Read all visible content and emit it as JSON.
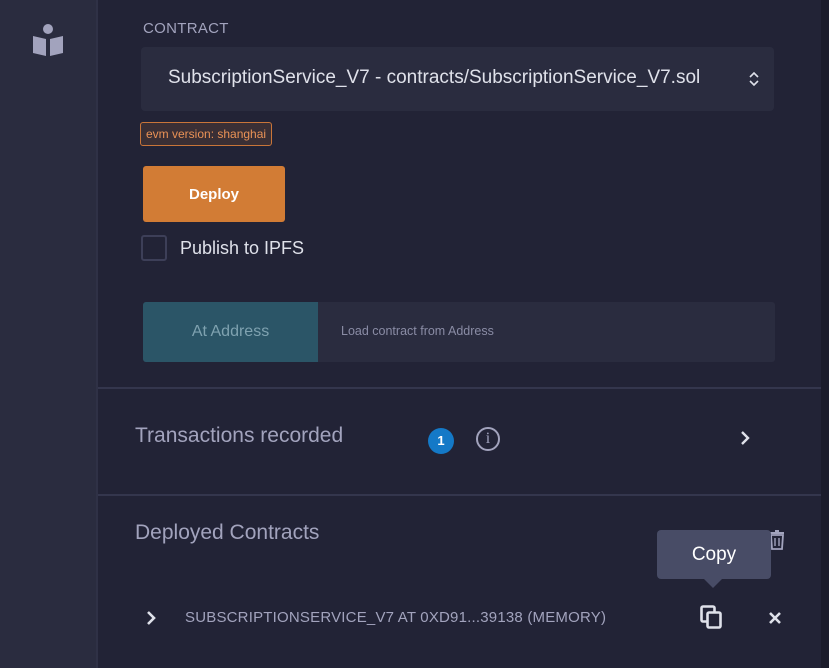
{
  "sidebar": {
    "icon": "plugin-icon"
  },
  "contract": {
    "label": "CONTRACT",
    "selected": "SubscriptionService_V7 - contracts/SubscriptionService_V7.sol",
    "evm_badge": "evm version: shanghai"
  },
  "deploy": {
    "button_label": "Deploy",
    "ipfs_label": "Publish to IPFS",
    "ipfs_checked": false
  },
  "at_address": {
    "button_label": "At Address",
    "placeholder": "Load contract from Address"
  },
  "transactions": {
    "label": "Transactions recorded",
    "count": "1",
    "info_icon": "info-icon",
    "info_glyph": "i"
  },
  "deployed": {
    "label": "Deployed Contracts",
    "tooltip": "Copy",
    "instance_label": "SUBSCRIPTIONSERVICE_V7 AT 0XD91...39138 (MEMORY)"
  },
  "colors": {
    "accent_orange": "#d27c35",
    "badge_blue": "#1479c7",
    "at_address_bg": "#2b5567"
  }
}
